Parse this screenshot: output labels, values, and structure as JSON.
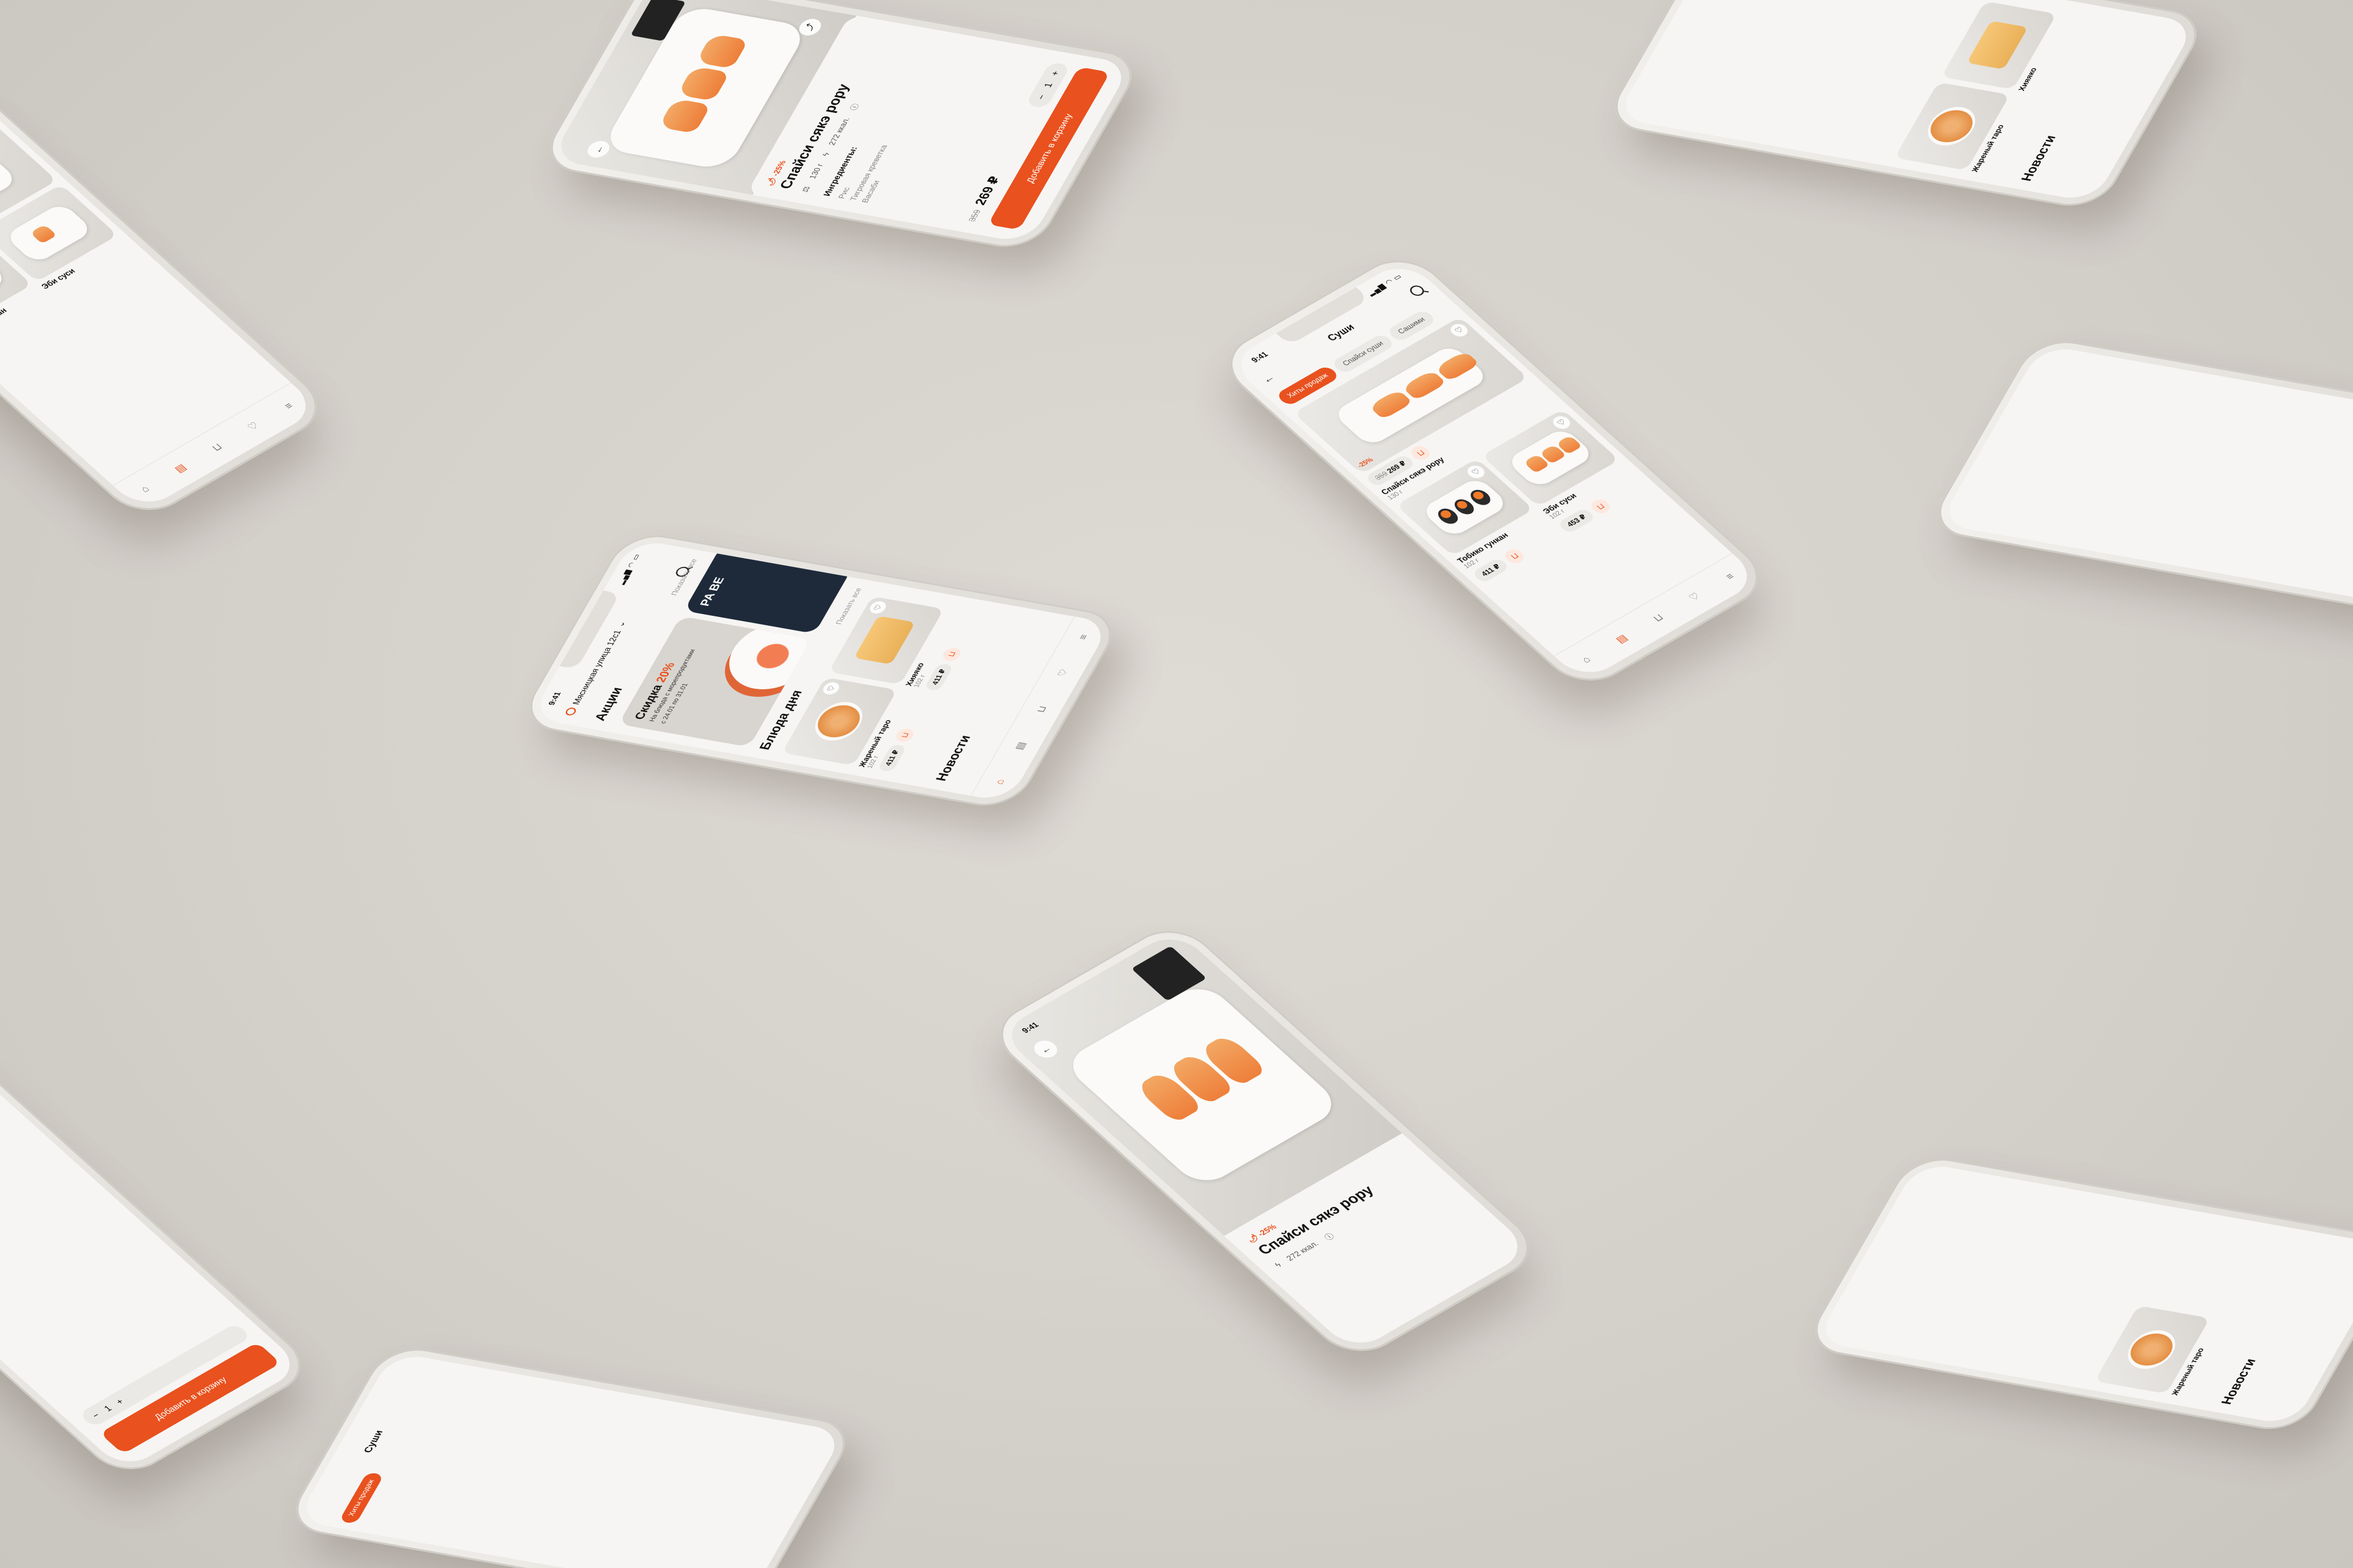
{
  "status_time": "9:41",
  "menu": {
    "title": "Суши",
    "chips": [
      "Хиты продаж",
      "Спайси суши",
      "Сашими"
    ],
    "products": [
      {
        "name": "Спайси сякэ рору",
        "weight": "130 г",
        "price": "269 ₽",
        "old_price": "359",
        "discount": "-25%"
      },
      {
        "name": "Тобико гункан",
        "weight": "102 г",
        "price": "411 ₽"
      },
      {
        "name": "Эби суси",
        "weight": "102 г",
        "price": "453 ₽"
      }
    ]
  },
  "detail": {
    "discount": "-25%",
    "title": "Спайси сякэ рору",
    "weight": "130 г",
    "kcal": "272 ккал.",
    "ingredients_title": "Ингредиенты:",
    "ingredients": [
      "Рис",
      "Тигровая креветка",
      "Васаби"
    ],
    "old_price": "359",
    "price": "269 ₽",
    "qty": "1",
    "add_label": "Добавить в корзину"
  },
  "home": {
    "address": "Мясницкая улица 12с1",
    "promos_title": "Акции",
    "show_all": "Показать все",
    "promo_title": "Скидка",
    "promo_percent": "20%",
    "promo_sub": "На блюда с морепродуктами",
    "promo_date": "с 24.01 по 31.01",
    "promo2_title": "PA BE",
    "dishes_title": "Блюда дня",
    "dishes": [
      {
        "name": "Жареный таро",
        "weight": "102 г",
        "price": "411 ₽"
      },
      {
        "name": "Хияяко",
        "weight": "102 г",
        "price": "411 ₽"
      }
    ],
    "news_title": "Новости"
  }
}
